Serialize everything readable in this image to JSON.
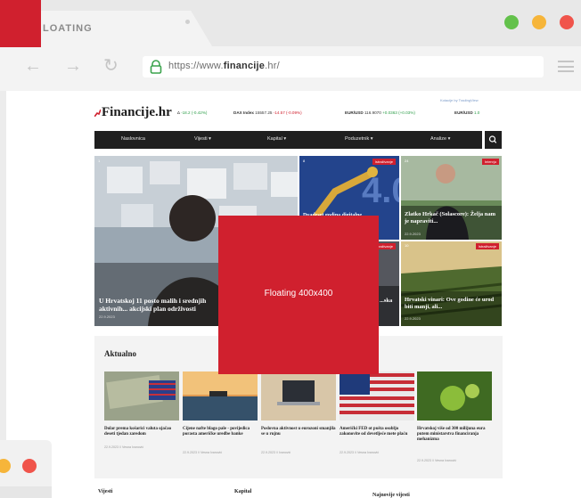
{
  "browser": {
    "tab_title": "LOATING",
    "url_prefix": "https://www.",
    "url_domain": "financije",
    "url_suffix": ".hr/",
    "window_buttons": [
      "#63c14b",
      "#f6b53a",
      "#f0544b"
    ]
  },
  "site": {
    "logo": "Financije.hr",
    "tradingview": "Kotacije by TradingView",
    "ticker": [
      {
        "label": "∆",
        "value": "-18.2 (-0.42%)",
        "trend": "up"
      },
      {
        "label": "DAX Index",
        "value": "15557.25",
        "change": "-14.57 (-0.09%)",
        "trend": "down"
      },
      {
        "label": "EUR/USD",
        "value": "116.9070",
        "change": "+0.0363 (+0.03%)",
        "trend": "up"
      },
      {
        "label": "EUR/USD",
        "value": "1.0",
        "trend": "up"
      }
    ],
    "nav": [
      "Naslovnica",
      "Vijesti ▾",
      "Kapital ▾",
      "Poduzetnik ▾",
      "Analize ▾"
    ],
    "hero": [
      {
        "title": "U Hrvatskoj 11 posto malih i srednjih aktivnih... akcijski plan održivosti",
        "date": "22.9.2023",
        "comments": "1",
        "badge": ""
      },
      {
        "title": "Dvadeset godina digitalne...",
        "date": "",
        "comments": "8",
        "badge": "Istraživanje"
      },
      {
        "title": "Zlatko Hrkač (Solascore): Želja nam je napraviti...",
        "date": "22.9.2023",
        "comments": "24",
        "badge": "Intervju"
      },
      {
        "title": "...ska",
        "date": "",
        "comments": "",
        "badge": "Istraživanje"
      },
      {
        "title": "Hrvatski vinari: Ove godine će urod biti manji, ali...",
        "date": "22.9.2023",
        "comments": "10",
        "badge": "Istraživanje"
      }
    ],
    "aktualno": {
      "title": "Aktualno",
      "cards": [
        {
          "title": "Dolar prema košarici valuta ojačao deseti tjedan zaredom",
          "meta": "22.9.2023 // Vesna Ivanović"
        },
        {
          "title": "Cijene nafte blago pale - povijedica porasta američke uredbe banke",
          "meta": "22.9.2023 // Vesna Ivanović"
        },
        {
          "title": "Poslovna aktivnost u eurozoni smanjila se u rujnu",
          "meta": "22.9.2023 // Ivanović"
        },
        {
          "title": "Američki FED ot pušta osobljo zakonovite od devetljeće mete plaću",
          "meta": "22.9.2023 // Vesna Ivanović"
        },
        {
          "title": "Hrvatskoj više od 300 milijuna eura putem ministarstva financiranja mehanizma",
          "meta": "22.9.2023 // Vesna Ivanović"
        }
      ]
    },
    "bottom_sections": [
      "Vijesti",
      "Kapital",
      "Najnovije vijesti"
    ]
  },
  "floating_ad": {
    "label": "Floating 400x400",
    "color": "#d0202e"
  }
}
